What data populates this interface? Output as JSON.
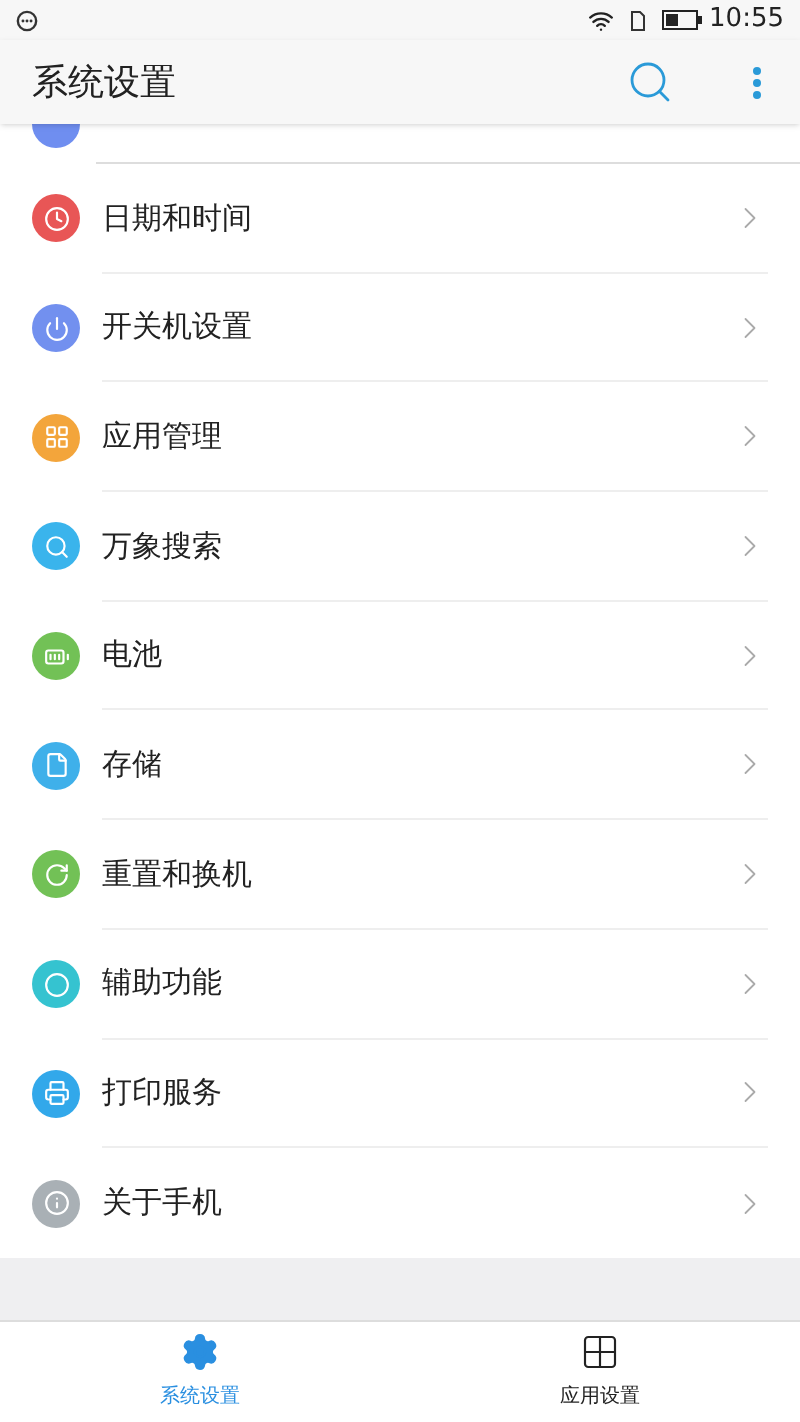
{
  "status_bar": {
    "time": "10:55"
  },
  "header": {
    "title": "系统设置"
  },
  "partial_item": {
    "color": "#6f8ef0"
  },
  "items": [
    {
      "label": "日期和时间",
      "kind": "clock",
      "color": "#e85656"
    },
    {
      "label": "开关机设置",
      "kind": "power",
      "color": "#7290ef"
    },
    {
      "label": "应用管理",
      "kind": "grid",
      "color": "#f3a53b"
    },
    {
      "label": "万象搜索",
      "kind": "search",
      "color": "#3ab4ec"
    },
    {
      "label": "电池",
      "kind": "battery",
      "color": "#72c156"
    },
    {
      "label": "存储",
      "kind": "storage",
      "color": "#3fb0ea"
    },
    {
      "label": "重置和换机",
      "kind": "reset",
      "color": "#72c156"
    },
    {
      "label": "辅助功能",
      "kind": "ring",
      "color": "#35c3d0"
    },
    {
      "label": "打印服务",
      "kind": "printer",
      "color": "#32a8ea"
    },
    {
      "label": "关于手机",
      "kind": "info",
      "color": "#a9b0b5"
    }
  ],
  "bottom_nav": [
    {
      "label": "系统设置",
      "kind": "gear",
      "selected": true
    },
    {
      "label": "应用设置",
      "kind": "apps",
      "selected": false
    }
  ]
}
